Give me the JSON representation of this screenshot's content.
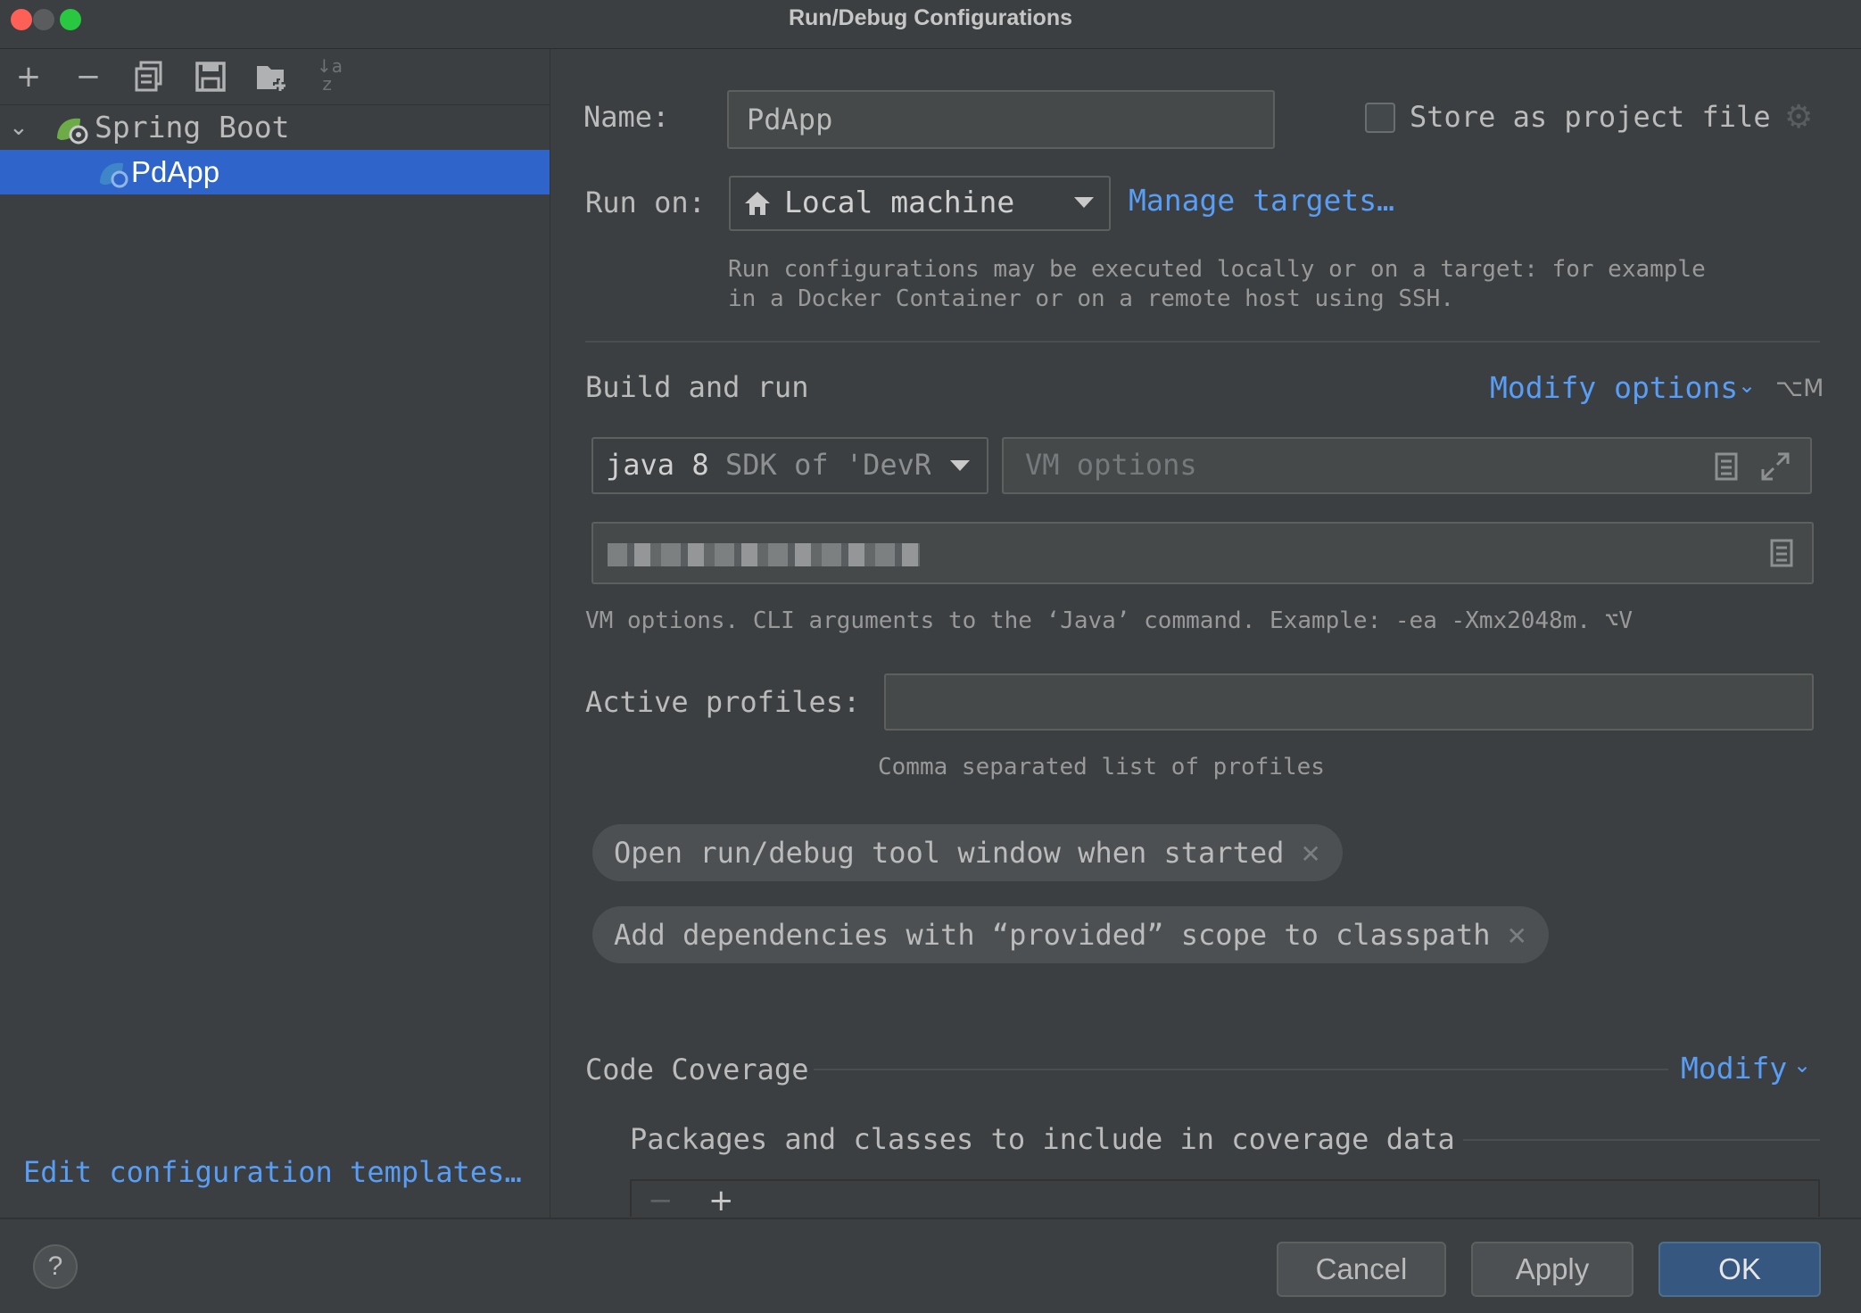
{
  "window": {
    "title": "Run/Debug Configurations"
  },
  "toolbar": {
    "add": "+",
    "remove": "−",
    "copy_icon": "copy-icon",
    "save_icon": "save-icon",
    "folder_icon": "new-folder-icon",
    "sort_icon": "sort-alpha-icon"
  },
  "tree": {
    "group_label": "Spring Boot",
    "item_label": "PdApp"
  },
  "left_footer": {
    "edit_templates": "Edit configuration templates…"
  },
  "form": {
    "name_label": "Name:",
    "name_value": "PdApp",
    "store_label": "Store as project file",
    "store_checked": false,
    "run_on_label": "Run on:",
    "run_on_value": "Local machine",
    "manage_targets": "Manage targets…",
    "run_on_hint_1": "Run configurations may be executed locally or on a target: for example",
    "run_on_hint_2": "in a Docker Container or on a remote host using SSH.",
    "build_run_title": "Build and run",
    "modify_options": "Modify options",
    "modify_options_shortcut": "⌥M",
    "jdk_main": "java 8",
    "jdk_sub": "SDK of 'DevRe",
    "vm_options_placeholder": "VM options",
    "vm_hint": "VM options. CLI arguments to the ‘Java’ command. Example: -ea -Xmx2048m. ⌥V",
    "active_profiles_label": "Active profiles:",
    "active_profiles_value": "",
    "profiles_hint": "Comma separated list of profiles",
    "chip_1": "Open run/debug tool window when started",
    "chip_2": "Add dependencies with “provided” scope to classpath",
    "coverage_title": "Code Coverage",
    "coverage_modify": "Modify",
    "coverage_packages": "Packages and classes to include in coverage data",
    "coverage_remove": "−",
    "coverage_add": "+"
  },
  "buttons": {
    "help": "?",
    "cancel": "Cancel",
    "apply": "Apply",
    "ok": "OK"
  },
  "colors": {
    "background": "#3c3f41",
    "selection": "#2f65ca",
    "link": "#589df6",
    "ok_button": "#365880"
  }
}
